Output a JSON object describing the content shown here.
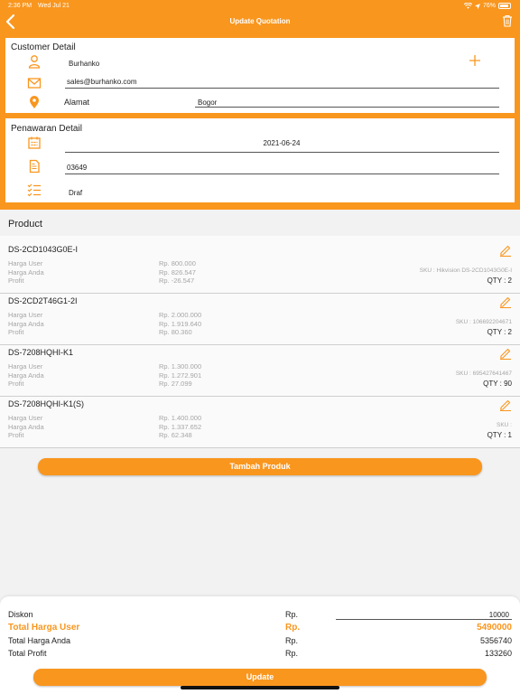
{
  "status_bar": {
    "time": "2:36 PM",
    "date": "Wed Jul 21",
    "battery": "76%"
  },
  "navbar": {
    "title": "Update Quotation"
  },
  "customer": {
    "title": "Customer Detail",
    "name": "Burhanko",
    "email": "sales@burhanko.com",
    "alamat_label": "Alamat",
    "alamat_value": "Bogor",
    "add_symbol": "+"
  },
  "penawaran": {
    "title": "Penawaran Detail",
    "date": "2021-06-24",
    "number": "03649",
    "status": "Draf"
  },
  "product_section": {
    "title": "Product"
  },
  "labels": {
    "harga_user": "Harga User",
    "harga_anda": "Harga Anda",
    "profit": "Profit"
  },
  "products": [
    {
      "name": "DS-2CD1043G0E-I",
      "harga_user": "Rp. 800.000",
      "harga_anda": "Rp. 826.547",
      "profit": "Rp. -26.547",
      "sku": "SKU : Hikvision DS-2CD1043G0E-I",
      "qty": "QTY : 2"
    },
    {
      "name": "DS-2CD2T46G1-2I",
      "harga_user": "Rp. 2.000.000",
      "harga_anda": "Rp. 1.919.640",
      "profit": "Rp. 80.360",
      "sku": "SKU : 106692204671",
      "qty": "QTY : 2"
    },
    {
      "name": "DS-7208HQHI-K1",
      "harga_user": "Rp. 1.300.000",
      "harga_anda": "Rp. 1.272.901",
      "profit": "Rp. 27.099",
      "sku": "SKU : 695427641467",
      "qty": "QTY : 90"
    },
    {
      "name": "DS-7208HQHI-K1(S)",
      "harga_user": "Rp. 1.400.000",
      "harga_anda": "Rp. 1.337.652",
      "profit": "Rp. 62.348",
      "sku": "SKU :",
      "qty": "QTY : 1"
    }
  ],
  "buttons": {
    "add_product": "Tambah Produk",
    "update": "Update"
  },
  "summary": {
    "diskon_label": "Diskon",
    "diskon_rp": "Rp.",
    "diskon_value": "10000",
    "total_user_label": "Total Harga User",
    "total_user_rp": "Rp.",
    "total_user_value": "5490000",
    "total_anda_label": "Total Harga Anda",
    "total_anda_rp": "Rp.",
    "total_anda_value": "5356740",
    "total_profit_label": "Total Profit",
    "total_profit_rp": "Rp.",
    "total_profit_value": "133260"
  },
  "colors": {
    "accent": "#f9961e",
    "muted_text": "#a6a6a6"
  }
}
